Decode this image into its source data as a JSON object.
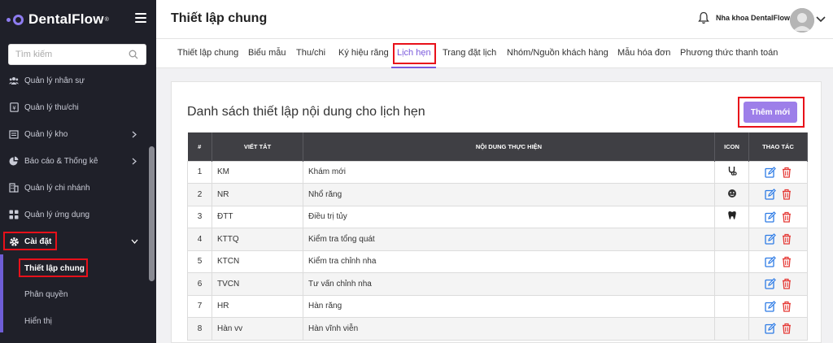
{
  "brand": {
    "name": "DentalFlow",
    "trademark": "®"
  },
  "search": {
    "placeholder": "Tìm kiếm"
  },
  "sidebar": {
    "items": [
      {
        "label": "Quản lý nhân sự",
        "icon": "users-icon"
      },
      {
        "label": "Quản lý thu/chi",
        "icon": "wallet-icon"
      },
      {
        "label": "Quản lý kho",
        "icon": "warehouse-icon",
        "has_children": true
      },
      {
        "label": "Báo cáo & Thống kê",
        "icon": "pie-chart-icon",
        "has_children": true
      },
      {
        "label": "Quản lý chi nhánh",
        "icon": "building-icon"
      },
      {
        "label": "Quản lý ứng dụng",
        "icon": "apps-icon"
      },
      {
        "label": "Cài đặt",
        "icon": "gear-icon",
        "expanded": true
      }
    ],
    "sub_items": [
      {
        "label": "Thiết lập chung",
        "active": true
      },
      {
        "label": "Phân quyền"
      },
      {
        "label": "Hiển thị"
      }
    ]
  },
  "header": {
    "title": "Thiết lập chung",
    "clinic_name": "Nha khoa DentalFlow"
  },
  "tabs": [
    {
      "label": "Thiết lập chung"
    },
    {
      "label": "Biểu mẫu"
    },
    {
      "label": "Thu/chi"
    },
    {
      "label": "Ký hiệu răng"
    },
    {
      "label": "Lịch hẹn",
      "active": true
    },
    {
      "label": "Trang đặt lịch"
    },
    {
      "label": "Nhóm/Nguồn khách hàng"
    },
    {
      "label": "Mẫu hóa đơn"
    },
    {
      "label": "Phương thức thanh toán"
    }
  ],
  "card": {
    "title": "Danh sách thiết lập nội dung cho lịch hẹn",
    "add_button": "Thêm mới"
  },
  "table": {
    "columns": [
      "#",
      "VIẾT TẮT",
      "NỘI DUNG THỰC HIỆN",
      "ICON",
      "THAO TÁC"
    ],
    "rows": [
      {
        "no": "1",
        "abbr": "KM",
        "content": "Khám mới",
        "icon": "stethoscope-icon"
      },
      {
        "no": "2",
        "abbr": "NR",
        "content": "Nhổ răng",
        "icon": "face-icon"
      },
      {
        "no": "3",
        "abbr": "ĐTT",
        "content": "Điều trị tủy",
        "icon": "tooth-icon"
      },
      {
        "no": "4",
        "abbr": "KTTQ",
        "content": "Kiểm tra tổng quát",
        "icon": ""
      },
      {
        "no": "5",
        "abbr": "KTCN",
        "content": "Kiểm tra chỉnh nha",
        "icon": ""
      },
      {
        "no": "6",
        "abbr": "TVCN",
        "content": "Tư vấn chỉnh nha",
        "icon": ""
      },
      {
        "no": "7",
        "abbr": "HR",
        "content": "Hàn răng",
        "icon": ""
      },
      {
        "no": "8",
        "abbr": "Hàn vv",
        "content": "Hàn vĩnh viễn",
        "icon": ""
      }
    ]
  },
  "colors": {
    "sidebar_bg": "#1f2029",
    "accent": "#7b5bdc",
    "button": "#9d7fe9",
    "highlight": "#e8101a",
    "edit": "#2d7be5",
    "delete": "#e53935"
  }
}
